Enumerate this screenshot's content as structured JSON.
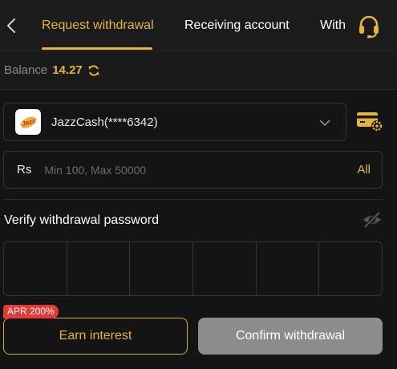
{
  "header": {
    "tabs": [
      {
        "label": "Request withdrawal",
        "active": true
      },
      {
        "label": "Receiving account",
        "active": false
      },
      {
        "label": "With",
        "active": false
      }
    ]
  },
  "balance": {
    "label": "Balance",
    "value": "14.27"
  },
  "account": {
    "name": "JazzCash(****6342)",
    "logo_text": "Jazz"
  },
  "amount": {
    "currency": "Rs",
    "placeholder": "Min 100, Max 50000",
    "all_label": "All"
  },
  "password": {
    "label": "Verify withdrawal password",
    "cells": 6
  },
  "actions": {
    "apr_badge": "APR 200%",
    "earn_label": "Earn interest",
    "confirm_label": "Confirm withdrawal"
  },
  "colors": {
    "accent": "#e5b53a",
    "badge": "#e53935",
    "disabled": "#8c8c8c"
  }
}
